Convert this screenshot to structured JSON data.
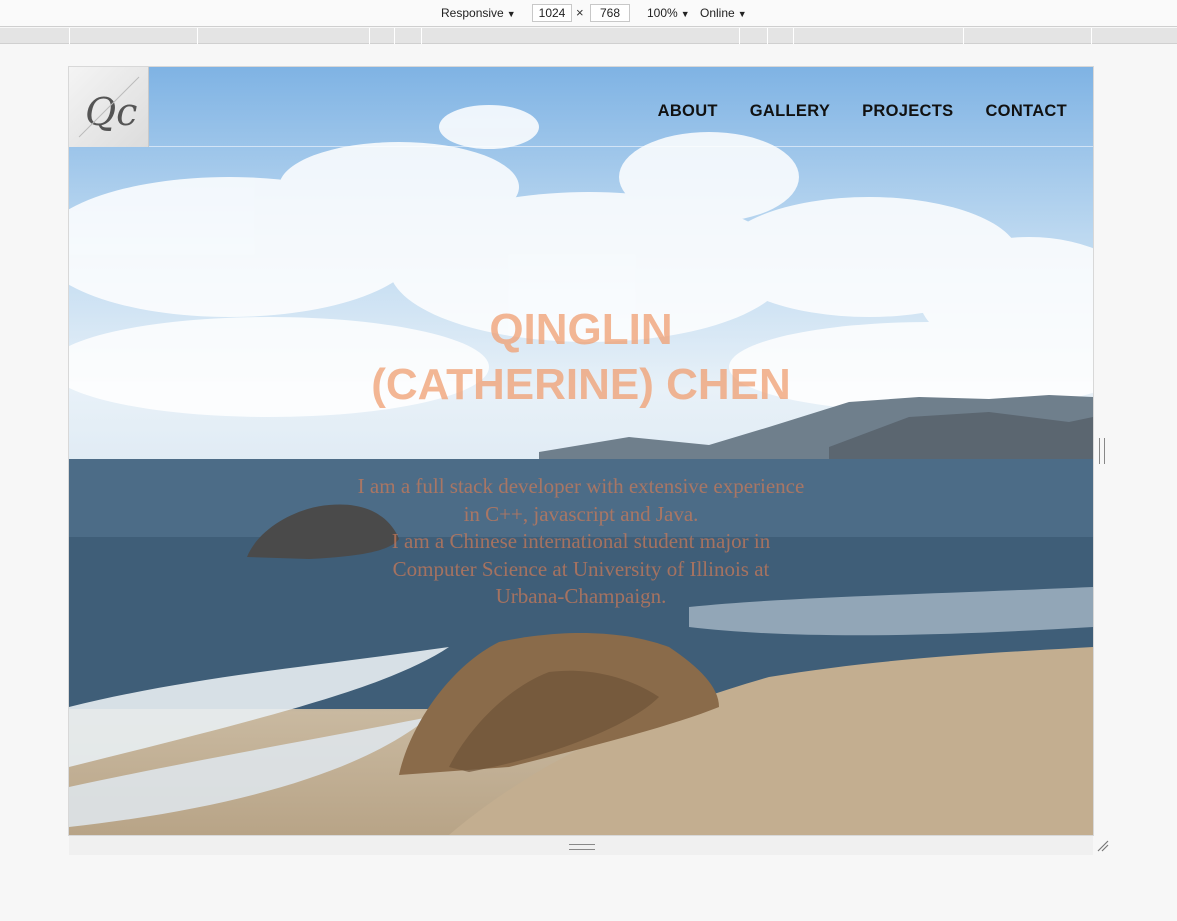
{
  "devtools": {
    "device_label": "Responsive",
    "width_value": "1024",
    "height_value": "768",
    "times_symbol": "×",
    "zoom_label": "100%",
    "network_label": "Online",
    "caret": "▼"
  },
  "site": {
    "logo_text": "Qc",
    "nav": [
      "ABOUT",
      "GALLERY",
      "PROJECTS",
      "CONTACT"
    ],
    "hero_title_lines": [
      "QINGLIN",
      "(CATHERINE) CHEN"
    ],
    "hero_desc_lines": [
      "I am a full stack developer with extensive experience",
      "in C++, javascript and Java.",
      "I am a Chinese international student major in",
      "Computer Science at University of Illinois at",
      "Urbana-Champaign."
    ]
  },
  "colors": {
    "title": "#efa276",
    "description": "#cd7a58",
    "nav_text": "#111111",
    "sky": "#7fb3e4",
    "ocean": "#39566f",
    "sand": "#c9b9a0"
  }
}
